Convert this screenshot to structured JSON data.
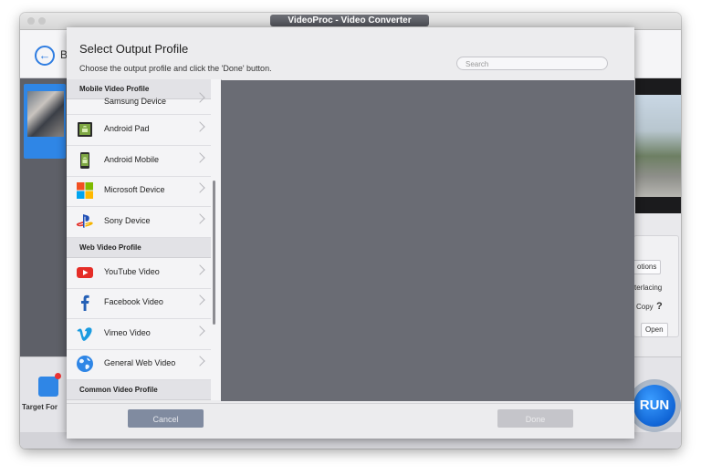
{
  "window": {
    "title": "VideoProc - Video Converter"
  },
  "app": {
    "back_label": "B",
    "target_label": "Target For",
    "run_label": "RUN",
    "right_panel": {
      "options": "otions",
      "interlacing": "terlacing",
      "copy": "Copy",
      "help": "?",
      "open": "Open"
    }
  },
  "dialog": {
    "title": "Select Output Profile",
    "subtitle": "Choose the output profile and click the 'Done' button.",
    "search_placeholder": "Search",
    "sections": [
      {
        "label": "Mobile Video Profile",
        "items": [
          {
            "label": "Samsung Device",
            "icon": "samsung-icon"
          },
          {
            "label": "Android Pad",
            "icon": "android-icon"
          },
          {
            "label": "Android Mobile",
            "icon": "android-icon"
          },
          {
            "label": "Microsoft Device",
            "icon": "microsoft-icon"
          },
          {
            "label": "Sony Device",
            "icon": "playstation-icon"
          }
        ]
      },
      {
        "label": "Web Video Profile",
        "items": [
          {
            "label": "YouTube Video",
            "icon": "youtube-icon"
          },
          {
            "label": "Facebook Video",
            "icon": "facebook-icon"
          },
          {
            "label": "Vimeo Video",
            "icon": "vimeo-icon"
          },
          {
            "label": "General Web Video",
            "icon": "globe-icon"
          }
        ]
      },
      {
        "label": "Common Video Profile",
        "items": []
      }
    ],
    "cancel_label": "Cancel",
    "done_label": "Done"
  },
  "colors": {
    "accent": "#2f86e6",
    "cancel_button": "#808ba0",
    "done_button_disabled": "#c5c5ca",
    "preview_pane": "#6a6c74"
  }
}
